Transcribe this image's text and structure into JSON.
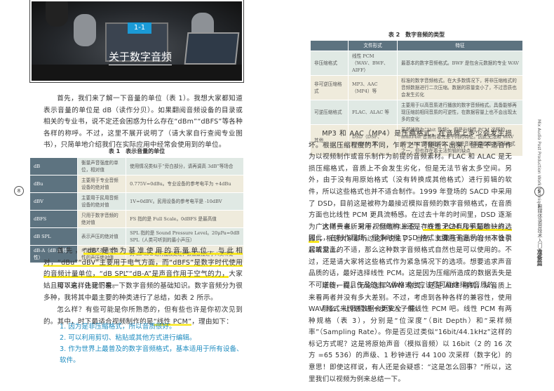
{
  "left_page": {
    "page_number": "8",
    "hero": {
      "badge": "1-1",
      "title": "关于数字音频"
    },
    "para1": "首先，我们来了解一下音量的单位（表 1）。我想大家都知道表示音量的单位是 dB（读作分贝）。如果翻阅音频设备的目录或相关的专业书，说不定还会困惑为什么存在“dBm”“dBFS”等各种各样的称呼。不过，这里不展开说明了（请大家自行查阅专业图书），只简单地介绍我们在实际应用中经常会使用到的单位。",
    "table1": {
      "caption": "表 1　表示音量的单位",
      "rows": [
        [
          "dB",
          "衡量声音强度的单位，相对值",
          "使用情况类似于“旁白部分，请再调高 3dB”等场合"
        ],
        [
          "dBu",
          "主要用于专业音频设备的绝对值",
          "0.775V=0dBu。专业设备的参考电平为 +4dBu"
        ],
        [
          "dBV",
          "主要用于民用音频设备的绝对值",
          "1V=0dBV。民用设备的参考电平是 -10dBV"
        ],
        [
          "dBFS",
          "只用于数字音频的绝对值",
          "FS 指的是 Full Scale。0dBFS 是最高值"
        ],
        [
          "dB SPL",
          "表示声压的绝对值",
          "SPL 指的是 Sound Pressure Level。20μPa=0dB SPL（人类可听到的最小声压）"
        ],
        [
          "dB-A（dB A 特性）",
          "考虑到人类听觉特性的声压绝对值",
          "对 dB SPL 进行加权处理，数值最接近于人类听觉"
        ]
      ]
    },
    "para2_pre": "首先，",
    "para2_hl": "“dB”是作为基准使用的音量单位，与此相对，“dBu”“dBV”主要用于电气方面，而“dBFS”是数字时代使用的音频计量单位，“dB SPL”“dB-A”是声音作用于空气的力，",
    "para2_post": "大家姑且可以这样先记下来。",
    "para3": "接下来，让我们看一下数字音频的基础知识。数字音频分为很多种，我将其中最主要的种类进行了总结，如表 2 所示。",
    "para4_pre": "怎么样？有些可能是你所熟悉的，但有些也许是你初次见到的。其中，时下最适合视频制作的是",
    "para4_hl": "“线性 PCM”",
    "para4_post": "，理由如下：",
    "list": [
      "1. 因为是非压缩格式，所以音质很好。",
      "2. 可以利用剪切、粘贴或其他方式进行编辑。",
      "3. 作为世界上最普及的数字音频格式，基本适用于所有设备、软件。"
    ]
  },
  "right_page": {
    "page_number": "9",
    "table2": {
      "caption": "表 2　数字音频的类型",
      "headers": [
        "",
        "文件形式",
        "特征"
      ],
      "rows": [
        [
          "非压缩格式",
          "线性 PCM（WAV、BWF、AIFF）",
          "最基本的数字音频格式。BWF 是包含元数据的专业 WAV"
        ],
        [
          "非可逆压缩格式",
          "MP3、AAC（MP4）等",
          "标准的数字音频格式。在大多数情况下，将非压缩格式的音频数据进行二次压缩。数据的容量变小了，不过音质也会发生劣化"
        ],
        [
          "可逆压缩格式",
          "FLAC、ALAC 等",
          "主要用于以高音质进行播放的数字音频格式。具备能够再现压缩前相同音质的可逆性，在数据容量上也不会出现太多的变化"
        ],
        [
          "其他",
          "DSD（DSF、DSDIFF 等）",
          "虽然被称为“1bit 音频”，但是与线性 PCM 这样的 multi-bit 音频有着完全不同的特征。因此无法和 WAV 的“24bit”等相提并论。目前是音质最高的数字音频格式之一，但也存在着无法剪辑的缺点"
        ]
      ]
    },
    "para1": "MP3 和 AAC（MP4）是压缩格式，在音质上多少会发生损坏。根据压缩程度的不同，乍听之下可能听不出来，但是不适合作为以视频制作或音乐制作为前提的音频素材。FLAC 和 ALAC 是无损压缩格式，音质上不会发生劣化，但是无法节省太多空间。另外，由于没有用原始格式（没有转换成其他格式）进行剪辑的软件，所以这些格式也并不适合制作。1999 年登场的 SACD 中采用了 DSD，目前这是被称为最接近模拟音频的数字音频格式，在音质方面也比线性 PCM 更具流畅感。在过去十年的时间里，DSD 逐渐为广大消费者所采用，但结构上还是存在着无法直接剪辑的缺点。因此，在制作现场，很多时候 DSD 格式主要用于音乐的一次性录音或混音。",
    "para2_pre": "这样一来，对于视频制作来说，",
    "para2_hl": "“线性 PCM 几乎是唯一的选择”",
    "para2_post": "，相信大家都听过这种说法了。当然，如果压缩后的音频不会引起听觉上的不适，那么这种数字音频格式自然也是可以使用的。不过，还是请大家将这些格式作为紧急情况下的选项。想要追求声音品质的话，最好选择线性 PCM。这是因为压缩所造成的数据丢失是不可逆的，而且作品的主文件格式也应该尽可能选择高音质的。",
    "para3": "顺便一提，无论选择 WAV 格式，还是 AIFF 格式，从音质上来看两者并没有多大差别。不过，考虑到各种各样的兼容性，使用 WAV 格式来传递数据会更安全一些。",
    "para4": "那么，让我们进一步深入了解线性 PCM 吧。线性 PCM 有两种规格（表 3），分别是“位深度”（Bit Depth）和“采样频率”（Sampling Rate）。你是否见过类似“16bit/44.1kHz”这样的标记方式呢？这是将原始声音（模拟音频）以 16bit（2 的 16 次方 =65 536）的声级、1 秒钟进行 44 100 次采样（数字化）的意思！即使这样说，有人还是会疑惑：“这是怎么回事？”所以，这里我们以视频为例来总结一下。",
    "sidebar_en": "Mix Audio Post Production Work Technique",
    "sidebar_cn": "自媒体录音技术入门与进阶",
    "sidebar_section": "准备篇"
  }
}
